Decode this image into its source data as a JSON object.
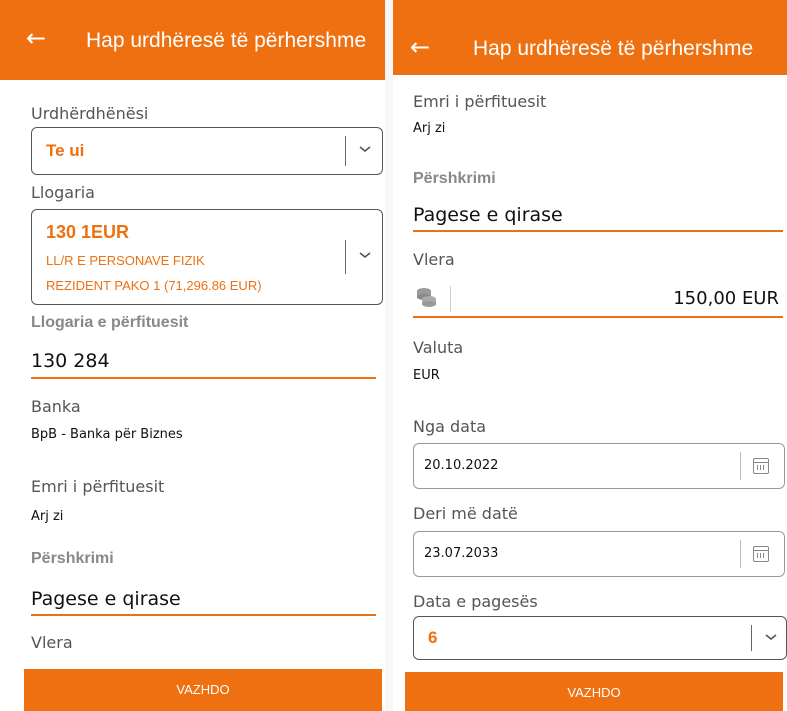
{
  "left": {
    "header": {
      "back_icon": "arrow-left-icon",
      "title": "Hap urdhëresë të përhershme"
    },
    "payer": {
      "label": "Urdhërdhënësi",
      "value": "Te        ui"
    },
    "account": {
      "label": "Llogaria",
      "number": "130         1EUR",
      "type": "LL/R E PERSONAVE FIZIK",
      "package": "REZIDENT PAKO 1 (71,296.86 EUR)"
    },
    "beneficiary_account": {
      "label": "Llogaria e përfituesit",
      "value": "130           284"
    },
    "bank": {
      "label": "Banka",
      "value": "BpB - Banka për Biznes"
    },
    "beneficiary_name": {
      "label": "Emri i përfituesit",
      "value": "Arj      zi"
    },
    "description": {
      "label": "Përshkrimi",
      "value": "Pagese e qirase"
    },
    "amount_label": "Vlera",
    "continue_label": "VAZHDO"
  },
  "right": {
    "header": {
      "back_icon": "arrow-left-icon",
      "title": "Hap urdhëresë të përhershme"
    },
    "beneficiary_name": {
      "label": "Emri i përfituesit",
      "value": "Arj      zi"
    },
    "description": {
      "label": "Përshkrimi",
      "value": "Pagese e qirase"
    },
    "amount": {
      "label": "Vlera",
      "value": "150,00 EUR",
      "icon": "coins-icon"
    },
    "currency": {
      "label": "Valuta",
      "value": "EUR"
    },
    "from_date": {
      "label": "Nga data",
      "value": "20.10.2022",
      "icon": "calendar-icon"
    },
    "to_date": {
      "label": "Deri më datë",
      "value": "23.07.2033",
      "icon": "calendar-icon"
    },
    "payment_day": {
      "label": "Data e pagesës",
      "value": "6"
    },
    "continue_label": "VAZHDO"
  },
  "colors": {
    "accent": "#ee7011",
    "text": "#222222",
    "label": "#555555"
  }
}
